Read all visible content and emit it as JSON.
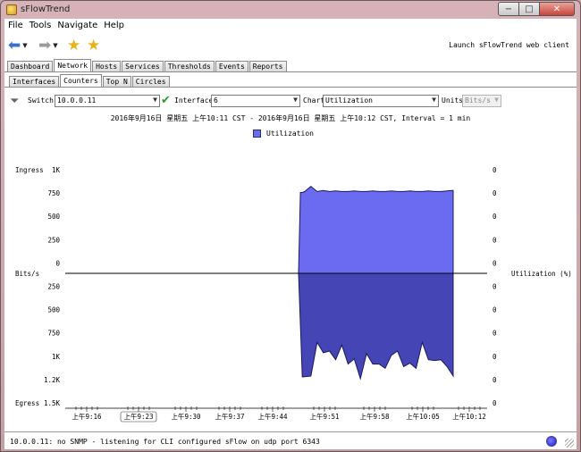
{
  "window": {
    "title": "sFlowTrend",
    "min": "−",
    "max": "□",
    "close": "✕"
  },
  "menu": [
    "File",
    "Tools",
    "Navigate",
    "Help"
  ],
  "toolbar": {
    "launch": "Launch sFlowTrend web client"
  },
  "tabs": [
    "Dashboard",
    "Network",
    "Hosts",
    "Services",
    "Thresholds",
    "Events",
    "Reports"
  ],
  "subtabs": [
    "Interfaces",
    "Counters",
    "Top N",
    "Circles"
  ],
  "controls": {
    "switch_label": "Switch",
    "switch_value": "10.0.0.11",
    "interface_label": "Interface",
    "interface_value": "6",
    "chart_label": "Chart",
    "chart_value": "Utilization",
    "units_label": "Units",
    "units_value": "Bits/s"
  },
  "chart_title": "2016年9月16日 星期五 上午10:11 CST - 2016年9月16日 星期五 上午10:12 CST, Interval = 1 min",
  "legend": "Utilization",
  "chart_data": {
    "type": "area",
    "left_labels": {
      "top": "Ingress",
      "middle": "Bits/s",
      "bottom": "Egress"
    },
    "right_label": "Utilization (%)",
    "left_ticks": [
      "1K",
      "750",
      "500",
      "250",
      "0",
      "250",
      "500",
      "750",
      "1K",
      "1.2K",
      "1.5K"
    ],
    "right_ticks": [
      "0",
      "0",
      "0",
      "0",
      "0",
      "0",
      "0",
      "0",
      "0",
      "0",
      "0"
    ],
    "x_ticks": [
      "上午9:16",
      "上午9:23",
      "上午9:30",
      "上午9:37",
      "上午9:44",
      "上午9:51",
      "上午9:58",
      "上午10:05",
      "上午10:12"
    ],
    "ingress": {
      "x": [
        0.0,
        0.03,
        0.06,
        0.1,
        0.2,
        0.3,
        0.4,
        0.5,
        0.6,
        0.7,
        0.8,
        0.9,
        1.0,
        1.1,
        1.2,
        1.3,
        1.4,
        1.5,
        1.6,
        1.7,
        1.8,
        1.9,
        2.0,
        2.1,
        2.2,
        2.3,
        2.4,
        2.5
      ],
      "values": [
        0,
        780,
        780,
        790,
        840,
        790,
        800,
        790,
        795,
        790,
        790,
        795,
        790,
        790,
        795,
        790,
        790,
        795,
        790,
        790,
        795,
        790,
        790,
        795,
        790,
        790,
        795,
        800
      ]
    },
    "egress": {
      "x": [
        0.0,
        0.06,
        0.2,
        0.3,
        0.4,
        0.5,
        0.6,
        0.7,
        0.8,
        0.9,
        1.0,
        1.1,
        1.2,
        1.3,
        1.4,
        1.5,
        1.6,
        1.7,
        1.8,
        1.9,
        2.0,
        2.1,
        2.2,
        2.3,
        2.4,
        2.5
      ],
      "values": [
        0,
        1200,
        1190,
        800,
        920,
        900,
        1000,
        830,
        1050,
        990,
        1220,
        930,
        1050,
        1050,
        1100,
        950,
        900,
        1080,
        1040,
        1100,
        800,
        1000,
        1010,
        1000,
        1080,
        1190
      ]
    },
    "ingress_max": 1000,
    "egress_max": 1500
  },
  "status": "10.0.0.11: no SNMP - listening for CLI configured sFlow on udp port 6343"
}
